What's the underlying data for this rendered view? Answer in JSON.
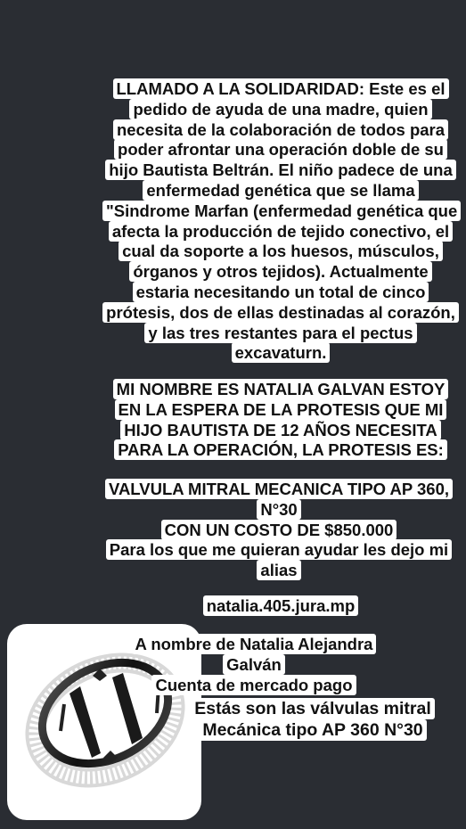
{
  "story": {
    "paragraph1": "LLAMADO A LA SOLIDARIDAD: Este es el pedido de ayuda de una madre, quien necesita de la colaboración de todos para poder afrontar una operación doble de su hijo Bautista Beltrán. El niño padece de una enfermedad genética que se llama \"Sindrome Marfan (enfermedad genética que afecta la producción de tejido conectivo, el cual da soporte a los huesos, músculos, órganos y otros tejidos). Actualmente estaria necesitando un total de cinco prótesis, dos de ellas destinadas al corazón, y las tres restantes para el pectus excavaturn.",
    "paragraph2": "MI NOMBRE ES NATALIA GALVAN ESTOY EN LA ESPERA DE LA PROTESIS QUE MI HIJO BAUTISTA DE 12 AÑOS NECESITA PARA LA OPERACIÓN, LA PROTESIS ES:",
    "valve_line": "VALVULA MITRAL MECANICA TIPO AP 360, N°30",
    "cost_line": "CON UN COSTO DE $850.000",
    "help_line": "Para los que me quieran ayudar les dejo mi alias",
    "alias": "natalia.405.jura.mp",
    "account_name": "A nombre de Natalia Alejandra Galván",
    "account_type": "Cuenta de mercado pago",
    "image_caption": "Estás son las válvulas mitral Mecánica tipo AP 360 N°30"
  },
  "colors": {
    "background": "#2a2d33",
    "text_highlight": "#ffffff",
    "text": "#111111"
  },
  "icons": {
    "valve_image": "mechanical-heart-valve-icon"
  }
}
